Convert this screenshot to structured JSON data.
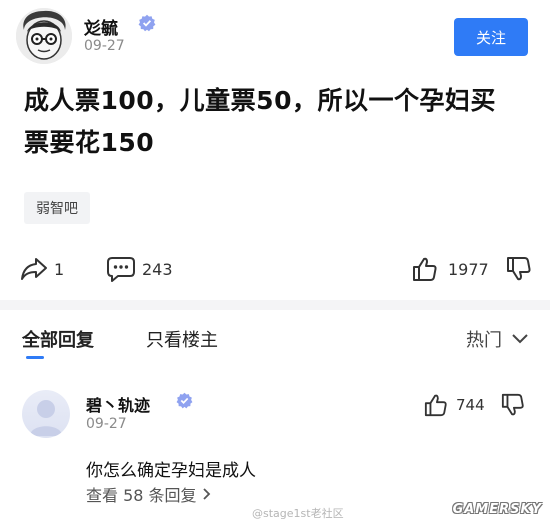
{
  "post": {
    "author": "彣毓",
    "date": "09-27",
    "follow_label": "关注",
    "body": "成人票100，儿童票50，所以一个孕妇买票要花150",
    "tag": "弱智吧",
    "share_count": "1",
    "comment_count": "243",
    "like_count": "1977"
  },
  "tabs": {
    "all_replies": "全部回复",
    "owner_only": "只看楼主",
    "sort_label": "热门"
  },
  "comment": {
    "author": "碧丶轨迹",
    "date": "09-27",
    "like_count": "744",
    "text": "你怎么确定孕妇是成人",
    "replies_label": "查看 58 条回复"
  },
  "watermark": {
    "weibo": "@stage1st老社区",
    "site": "GAMERSKY"
  },
  "colors": {
    "accent": "#2f7bf6",
    "badge": "#8fa2f0"
  }
}
